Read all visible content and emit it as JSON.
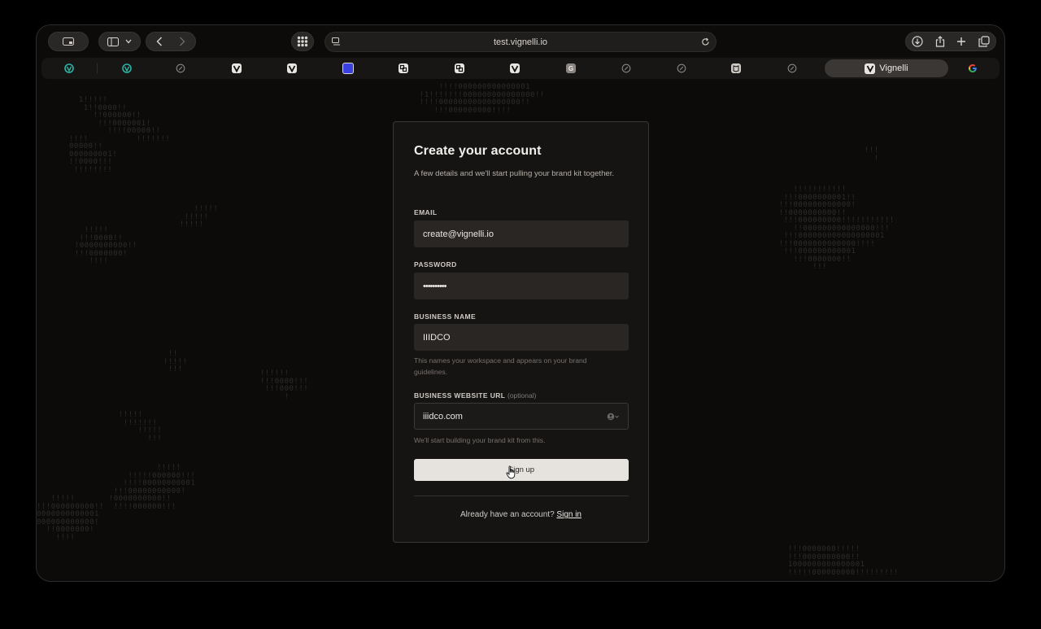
{
  "browser": {
    "url": "test.vignelli.io",
    "tabs": [
      {
        "icon": "vuetify-icon",
        "color": "#2bb5a5"
      },
      {
        "icon": "vuetify-icon",
        "color": "#2bb5a5"
      },
      {
        "icon": "compass-icon",
        "color": "#8a8581"
      },
      {
        "icon": "vignelli-icon",
        "color": "#e8e4e0"
      },
      {
        "icon": "vignelli-icon",
        "color": "#e8e4e0"
      },
      {
        "icon": "square-icon",
        "color": "#3a3fe0"
      },
      {
        "icon": "flow-icon",
        "color": "#e8e4e0"
      },
      {
        "icon": "flow-icon",
        "color": "#e8e4e0"
      },
      {
        "icon": "vignelli-icon",
        "color": "#e8e4e0"
      },
      {
        "icon": "g-square-icon",
        "color": "#8a8581"
      },
      {
        "icon": "compass-icon",
        "color": "#8a8581"
      },
      {
        "icon": "compass-icon",
        "color": "#8a8581"
      },
      {
        "icon": "book-icon",
        "color": "#cfcac4"
      },
      {
        "icon": "compass-icon",
        "color": "#8a8581"
      }
    ],
    "active_tab_label": "Vignelli",
    "last_tab_icon": "google-icon"
  },
  "form": {
    "title": "Create your account",
    "subtitle": "A few details and we'll start pulling your brand kit together.",
    "email_label": "EMAIL",
    "email_value": "create@vignelli.io",
    "password_label": "PASSWORD",
    "password_value": "••••••••••",
    "business_name_label": "BUSINESS NAME",
    "business_name_value": "IIIDCO",
    "business_name_help": "This names your workspace and appears on your brand guidelines.",
    "website_label": "BUSINESS WEBSITE URL",
    "website_optional": "(optional)",
    "website_value": "iiidco.com",
    "website_help": "We'll start building your brand kit from this.",
    "signup_label": "Sign up",
    "footer_text": "Already have an account?",
    "signin_label": "Sign in"
  },
  "colors": {
    "background": "#0d0b0a",
    "card": "#161413",
    "button": "#e6e3df",
    "matrix_text": "#2f2b28"
  }
}
